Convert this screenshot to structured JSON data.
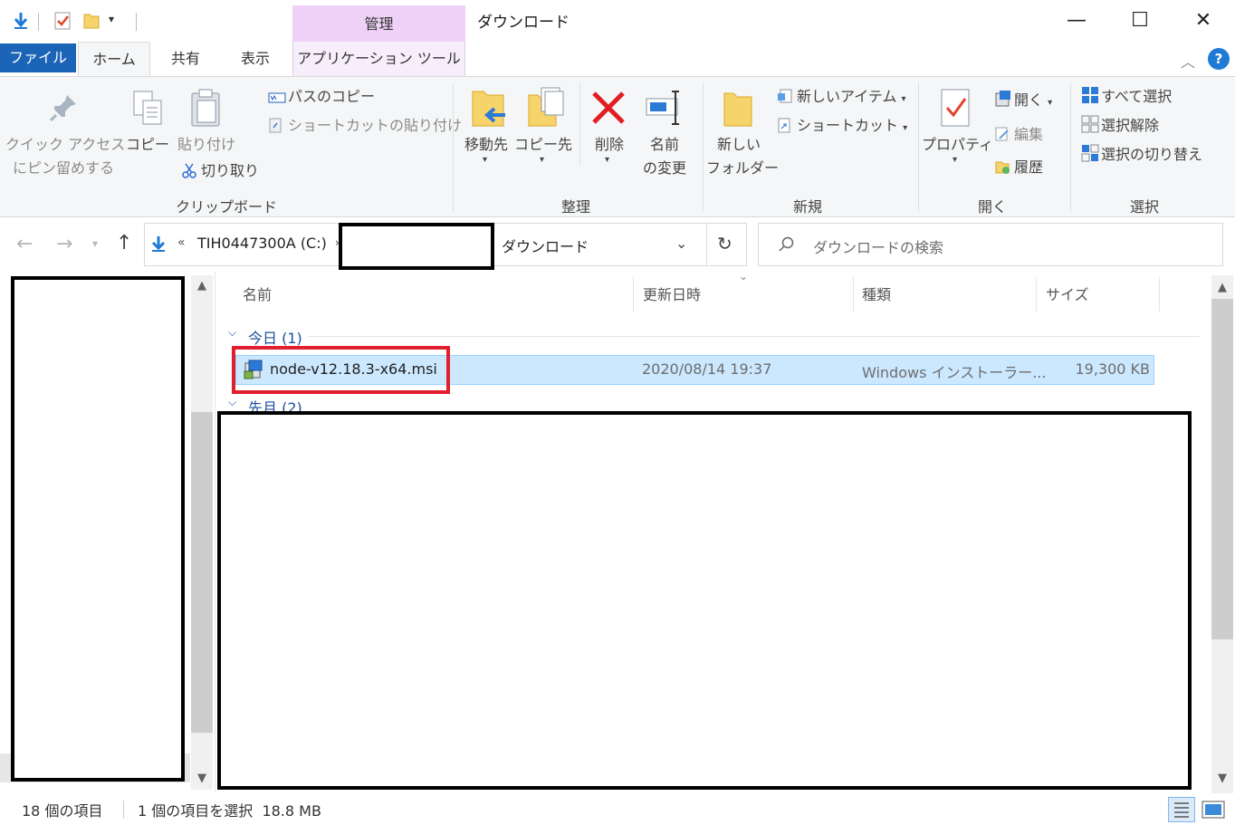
{
  "titlebar": {
    "window_title": "ダウンロード",
    "contextual_tab_group": "管理",
    "minimize_glyph": "—",
    "maximize_glyph": "☐",
    "close_glyph": "✕"
  },
  "tabs": {
    "file": "ファイル",
    "home": "ホーム",
    "share": "共有",
    "view": "表示",
    "app_tools": "アプリケーション ツール"
  },
  "ribbon": {
    "clipboard": {
      "label": "クリップボード",
      "pin_line1": "クイック アクセス",
      "pin_line2": "にピン留めする",
      "copy": "コピー",
      "paste": "貼り付け",
      "copy_path": "パスのコピー",
      "paste_shortcut": "ショートカットの貼り付け",
      "cut": "切り取り"
    },
    "organize": {
      "label": "整理",
      "move_to": "移動先",
      "copy_to": "コピー先",
      "delete": "削除",
      "rename_line1": "名前",
      "rename_line2": "の変更"
    },
    "new": {
      "label": "新規",
      "new_folder_line1": "新しい",
      "new_folder_line2": "フォルダー",
      "new_item": "新しいアイテム",
      "easy_access": "ショートカット"
    },
    "open": {
      "label": "開く",
      "properties": "プロパティ",
      "open": "開く",
      "edit": "編集",
      "history": "履歴"
    },
    "select": {
      "label": "選択",
      "select_all": "すべて選択",
      "select_none": "選択解除",
      "invert": "選択の切り替え"
    }
  },
  "nav": {
    "breadcrumb_overflow": "«",
    "drive": "TIH0447300A (C:)",
    "current": "ダウンロード",
    "search_placeholder": "ダウンロードの検索"
  },
  "columns": {
    "name": "名前",
    "modified": "更新日時",
    "type": "種類",
    "size": "サイズ"
  },
  "groups": {
    "today": "今日 (1)",
    "last_month": "先月 (2)"
  },
  "files": [
    {
      "name": "node-v12.18.3-x64.msi",
      "modified": "2020/08/14 19:37",
      "type": "Windows インストーラー...",
      "size": "19,300 KB"
    }
  ],
  "status": {
    "item_count": "18 個の項目",
    "selection": "1 個の項目を選択  18.8 MB"
  },
  "colors": {
    "file_tab": "#1c64b8",
    "manage_tab": "#efd1f7",
    "selection": "#cce8ff",
    "highlight_box": "#e0202f"
  }
}
